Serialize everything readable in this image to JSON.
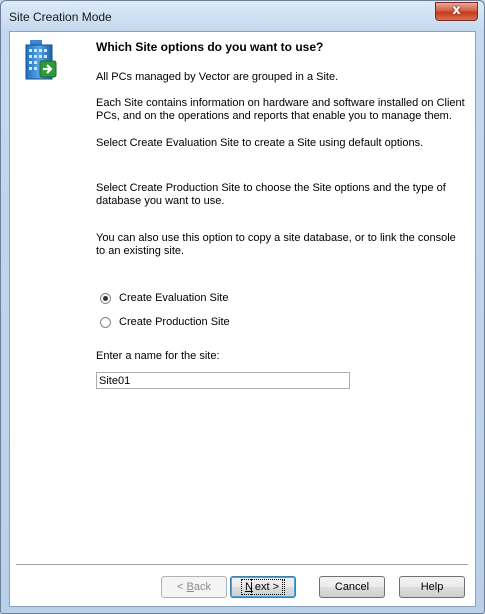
{
  "window": {
    "title": "Site Creation Mode",
    "close_glyph": "x"
  },
  "icon": "building-arrow-icon",
  "heading": "Which Site options do you want to use?",
  "paragraphs": [
    "All PCs managed by Vector are grouped in a Site.",
    "Each Site contains information on hardware and software installed on Client PCs, and on the operations and reports that enable you to manage them.",
    "Select Create Evaluation Site to create a Site using default options.",
    "Select Create Production Site to choose the Site options and the type of database you want to use.",
    "You can also use this option to copy a site database, or  to link the console to an existing site."
  ],
  "options": [
    {
      "label": "Create Evaluation Site",
      "selected": true
    },
    {
      "label": "Create Production Site",
      "selected": false
    }
  ],
  "name_field": {
    "label": "Enter a name for the site:",
    "value": "Site01"
  },
  "buttons": {
    "back": {
      "prefix": "< ",
      "mnemonic": "B",
      "rest": "ack",
      "enabled": false
    },
    "next": {
      "mnemonic": "N",
      "rest": "ext >",
      "default": true
    },
    "cancel": "Cancel",
    "help": "Help"
  }
}
